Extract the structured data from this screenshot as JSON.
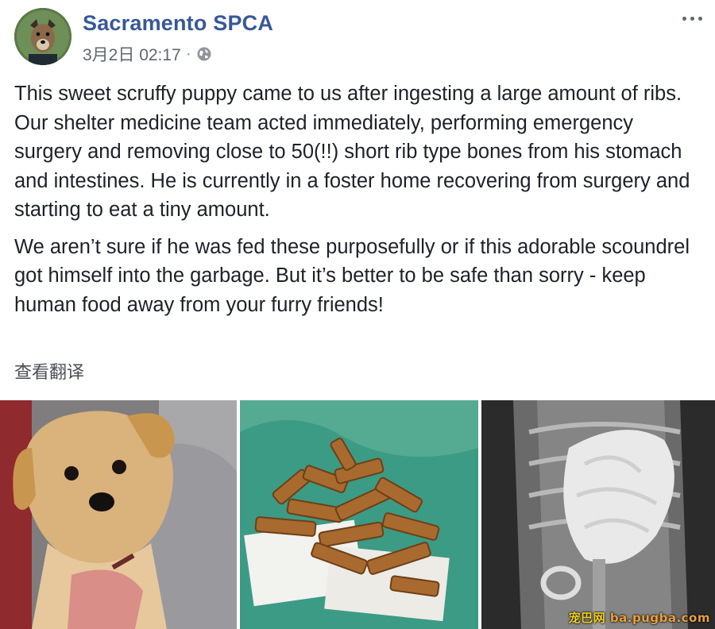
{
  "post": {
    "page_name": "Sacramento SPCA",
    "timestamp": "3月2日 02:17",
    "separator": "·",
    "privacy_icon": "globe-icon",
    "more_icon": "more-options-icon",
    "paragraphs": [
      "This sweet scruffy puppy came to us after ingesting a large amount of ribs.\nOur shelter medicine team acted immediately, performing emergency surgery and removing close to 50(!!) short rib type bones from his stomach and intestines. He is currently in a foster home recovering from surgery and starting to eat a tiny amount.",
      "We aren’t sure if he was fed these purposefully or if this adorable scoundrel got himself into the garbage. But it’s better to be safe than sorry - keep human food away from your furry friends!"
    ],
    "translate_label": "查看翻译"
  },
  "watermark": {
    "cn": "宠巴网",
    "url": "ba.pugba.com"
  },
  "colors": {
    "page_name": "#385898",
    "body_text": "#1d2129",
    "meta_text": "#616770",
    "watermark": "#e8a13a"
  }
}
